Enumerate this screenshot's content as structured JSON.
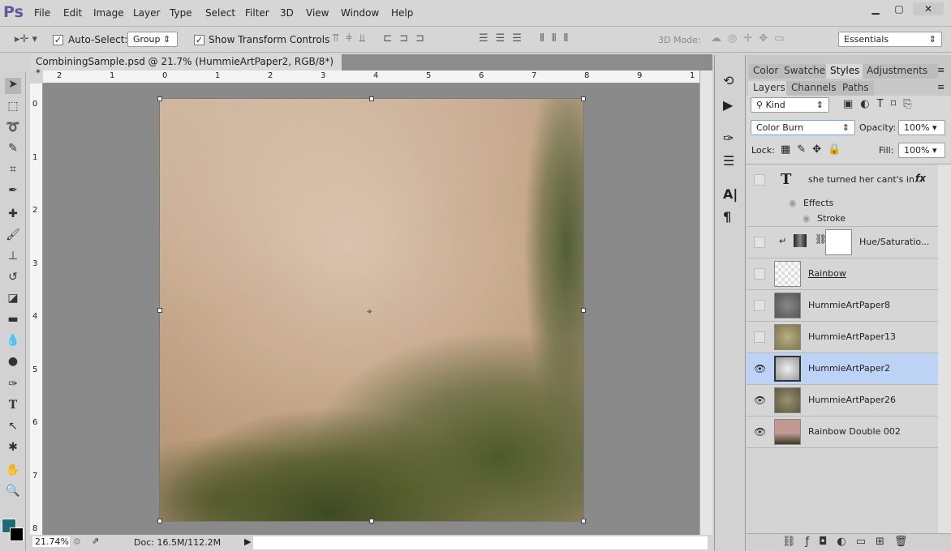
{
  "app": {
    "logo": "Ps",
    "menu": [
      "File",
      "Edit",
      "Image",
      "Layer",
      "Type",
      "Select",
      "Filter",
      "3D",
      "View",
      "Window",
      "Help"
    ],
    "window_controls": [
      "minimize",
      "maximize",
      "close"
    ]
  },
  "options": {
    "auto_select_label": "Auto-Select:",
    "auto_select_checked": true,
    "auto_select_value": "Group",
    "show_transform_label": "Show Transform Controls",
    "show_transform_checked": true,
    "mode_3d_label": "3D Mode:",
    "workspace": "Essentials"
  },
  "document": {
    "tab_title": "CombiningSample.psd @ 21.7% (HummieArtPaper2, RGB/8*) *",
    "close": "×",
    "zoom": "21.74%",
    "doc_size": "Doc: 16.5M/112.2M",
    "ruler_top": [
      "2",
      "1",
      "0",
      "1",
      "2",
      "3",
      "4",
      "5",
      "6",
      "7",
      "8",
      "9",
      "1"
    ],
    "ruler_left": [
      "0",
      "1",
      "2",
      "3",
      "4",
      "5",
      "6",
      "7",
      "8"
    ]
  },
  "colors": {
    "foreground": "#1e6b78",
    "background": "#000000",
    "selected_layer": "#bcd3f5"
  },
  "panels": {
    "top_tabs": [
      "Color",
      "Swatches",
      "Styles",
      "Adjustments"
    ],
    "active_top_tab": "Styles",
    "layer_tabs": [
      "Layers",
      "Channels",
      "Paths"
    ],
    "active_layer_tab": "Layers",
    "filter_kind": "Kind",
    "blend_mode": "Color Burn",
    "opacity_label": "Opacity:",
    "opacity": "100%",
    "lock_label": "Lock:",
    "fill_label": "Fill:",
    "fill": "100%"
  },
  "layers": [
    {
      "name": "she turned her cant's in...",
      "type": "text",
      "visible": false,
      "fx": "fx",
      "effects_label": "Effects",
      "effect": "Stroke"
    },
    {
      "name": "Hue/Saturatio...",
      "type": "adjustment",
      "visible": false
    },
    {
      "name": "Rainbow",
      "type": "transparent",
      "visible": false
    },
    {
      "name": "HummieArtPaper8",
      "visible": false
    },
    {
      "name": "HummieArtPaper13",
      "visible": false
    },
    {
      "name": "HummieArtPaper2",
      "visible": true,
      "selected": true
    },
    {
      "name": "HummieArtPaper26",
      "visible": true
    },
    {
      "name": "Rainbow Double 002",
      "visible": true
    }
  ]
}
